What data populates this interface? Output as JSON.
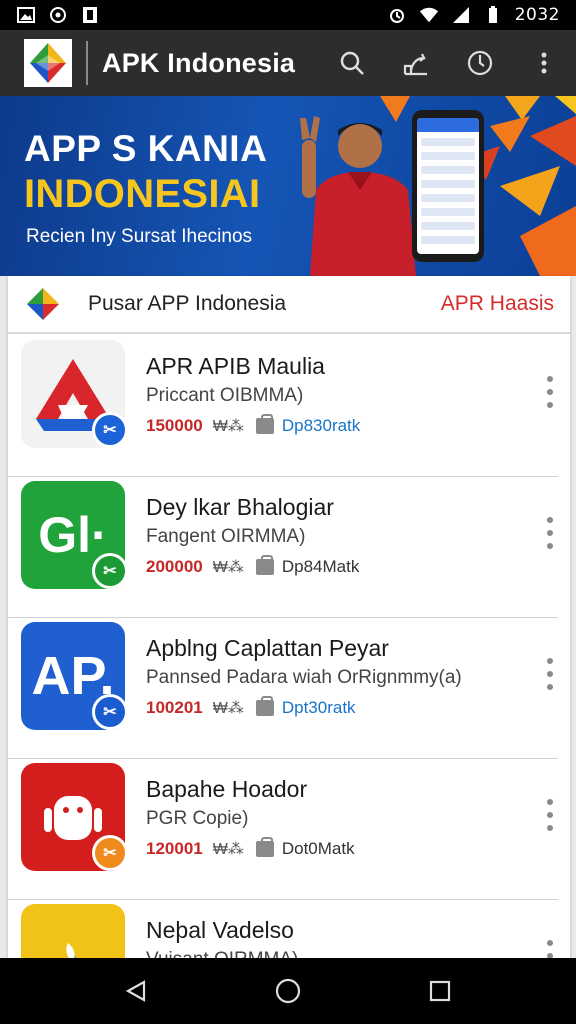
{
  "status_bar": {
    "time": "2032",
    "left_icons": [
      "image-icon",
      "settings-icon",
      "notification-icon"
    ],
    "right_icons": [
      "alarm-icon",
      "wifi-icon",
      "signal-icon",
      "battery-icon"
    ]
  },
  "app_bar": {
    "title": "APK Indonesia",
    "actions": [
      "search-icon",
      "share-icon",
      "timer-icon",
      "more-vertical-icon"
    ]
  },
  "banner": {
    "title": "APP S KANIA",
    "subtitle": "INDONESIAI",
    "caption": "Recien Iny Sursat Ihecinos",
    "accent": "#f6c51e"
  },
  "card": {
    "title": "Pusar APP Indonesia",
    "action_label": "APR Haasis",
    "action_color": "#d52b2b"
  },
  "apps": [
    {
      "name": "APR APIB Maulia",
      "subtitle": "Priccant OIBMMA)",
      "downloads": "150000",
      "rating_glyph": "₩⁂",
      "size": "Dp830ratk",
      "size_color": "#1a73c9",
      "icon_text": "",
      "icon_bg": "#f2f2f2",
      "badge_color": "#1b63d6",
      "icon_name": "triangle-app-icon"
    },
    {
      "name": "Dey lkar Bhalogiar",
      "subtitle": "Fangent OIRMMA)",
      "downloads": "200000",
      "rating_glyph": "₩⁂",
      "size": "Dp84Matk",
      "size_color": "#333333",
      "icon_text": "Gl·",
      "icon_bg": "#1fa33a",
      "badge_color": "#1c9a35",
      "icon_name": "gl-app-icon"
    },
    {
      "name": "Apblng Caplattan Peyar",
      "subtitle": "Pannsed Padara wiah OrRignmmy(a)",
      "downloads": "100201",
      "rating_glyph": "₩⁂",
      "size": "Dpt30ratk",
      "size_color": "#1a73c9",
      "icon_text": "AP.",
      "icon_bg": "#1f5fcf",
      "badge_color": "#1a5bd0",
      "icon_name": "ap-app-icon"
    },
    {
      "name": "Bapahe Hoador",
      "subtitle": "PGR Copie)",
      "downloads": "120001",
      "rating_glyph": "₩⁂",
      "size": "Dot0Matk",
      "size_color": "#333333",
      "icon_text": "",
      "icon_bg": "#d41e1e",
      "badge_color": "#f08a1c",
      "icon_name": "robot-app-icon"
    },
    {
      "name": "Neþal Vadelso",
      "subtitle": "Vuisant OIRMMA)",
      "downloads": "",
      "rating_glyph": "",
      "size": "",
      "size_color": "#333333",
      "icon_text": "",
      "icon_bg": "#f1c319",
      "badge_color": "#1fa33a",
      "icon_name": "leaf-app-icon"
    }
  ],
  "nav_bar": {
    "buttons": [
      "back-icon",
      "home-icon",
      "recents-icon"
    ]
  }
}
